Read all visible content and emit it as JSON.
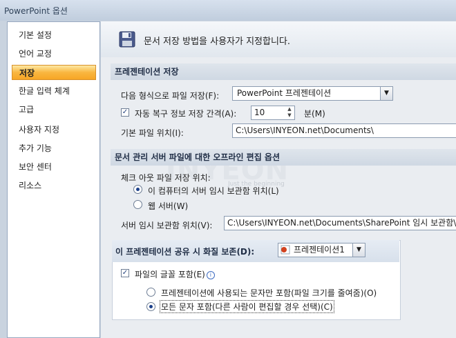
{
  "window": {
    "title": "PowerPoint 옵션"
  },
  "sidebar": {
    "items": [
      {
        "label": "기본 설정"
      },
      {
        "label": "언어 교정"
      },
      {
        "label": "저장"
      },
      {
        "label": "한글 입력 체계"
      },
      {
        "label": "고급"
      },
      {
        "label": "사용자 지정"
      },
      {
        "label": "추가 기능"
      },
      {
        "label": "보안 센터"
      },
      {
        "label": "리소스"
      }
    ],
    "selected": "저장"
  },
  "header": {
    "text": "문서 저장 방법을 사용자가 지정합니다.",
    "icon": "floppy-disk-icon"
  },
  "save_section": {
    "title": "프레젠테이션 저장",
    "format_label": "다음 형식으로 파일 저장(F):",
    "format_value": "PowerPoint 프레젠테이션",
    "autorecover_label": "자동 복구 정보 저장 간격(A):",
    "autorecover_checked": true,
    "autorecover_value": "10",
    "autorecover_unit": "분(M)",
    "default_location_label": "기본 파일 위치(I):",
    "default_location_value": "C:\\Users\\INYEON.net\\Documents\\"
  },
  "offline_section": {
    "title": "문서 관리 서버 파일에 대한 오프라인 편집 옵션",
    "checkout_label": "체크 아웃 파일 저장 위치:",
    "radio_local": "이 컴퓨터의 서버 임시 보관함 위치(L)",
    "radio_web": "웹 서버(W)",
    "selected": "local",
    "server_drafts_label": "서버 임시 보관함 위치(V):",
    "server_drafts_value": "C:\\Users\\INYEON.net\\Documents\\SharePoint 임시 보관함\\"
  },
  "fidelity_section": {
    "title": "이 프레젠테이션 공유 시 화질 보존(D):",
    "presentation_value": "프레젠테이션1",
    "embed_fonts_label": "파일의 글꼴 포함(E)",
    "embed_fonts_checked": true,
    "radio_used_chars": "프레젠테이션에 사용되는 문자만 포함(파일 크기를 줄여줌)(O)",
    "radio_all_chars": "모든 문자 포함(다른 사람이 편집할 경우 선택)(C)",
    "selected": "all"
  },
  "watermark": {
    "text": "INYEON",
    "subtext": "Just the beginning"
  }
}
